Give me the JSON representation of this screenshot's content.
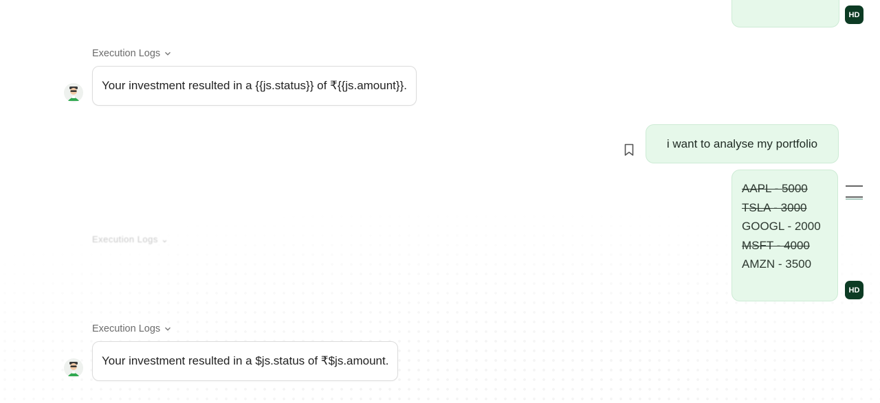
{
  "messages": {
    "user_avatar_initials": "HD",
    "execution_logs_label": "Execution Logs",
    "bot_message_1": "Your investment resulted in a {{js.status}} of ₹{{js.amount}}.",
    "user_message_1": "i want to analyse my portfolio",
    "portfolio_lines": [
      "AAPL - 5000",
      "TSLA - 3000",
      "GOOGL - 2000",
      "MSFT - 4000",
      "AMZN - 3500"
    ],
    "ghost_text": "Execution Logs ⌄",
    "bot_message_2": "Your investment resulted in a $js.status of ₹$js.amount."
  },
  "colors": {
    "user_bubble": "#e6f8ea",
    "avatar_bg": "#0d3b24"
  },
  "icons": [
    "bookmark-icon",
    "chevron-down-icon",
    "menu-lines-icon",
    "bot-avatar-icon"
  ]
}
